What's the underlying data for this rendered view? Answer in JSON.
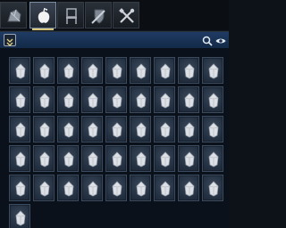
{
  "tabs": [
    {
      "id": "materials",
      "icon": "ore-icon",
      "active": false
    },
    {
      "id": "consumables",
      "icon": "fruit-icon",
      "active": true
    },
    {
      "id": "furniture",
      "icon": "chair-icon",
      "active": false
    },
    {
      "id": "equipment",
      "icon": "shield-sword-icon",
      "active": false
    },
    {
      "id": "tools",
      "icon": "crossed-tools-icon",
      "active": false
    }
  ],
  "toolbar": {
    "sort_icon": "sort-icon",
    "search_icon": "search-icon",
    "view_icon": "eye-icon"
  },
  "inventory": {
    "item_icon": "crystal-ore-icon",
    "rows_visible": 5,
    "columns": 9,
    "colors": {
      "slot": "#243142",
      "slot_border": "#3a4a5f",
      "item": "#d9dce0",
      "toolbar": "#1a3558"
    }
  }
}
